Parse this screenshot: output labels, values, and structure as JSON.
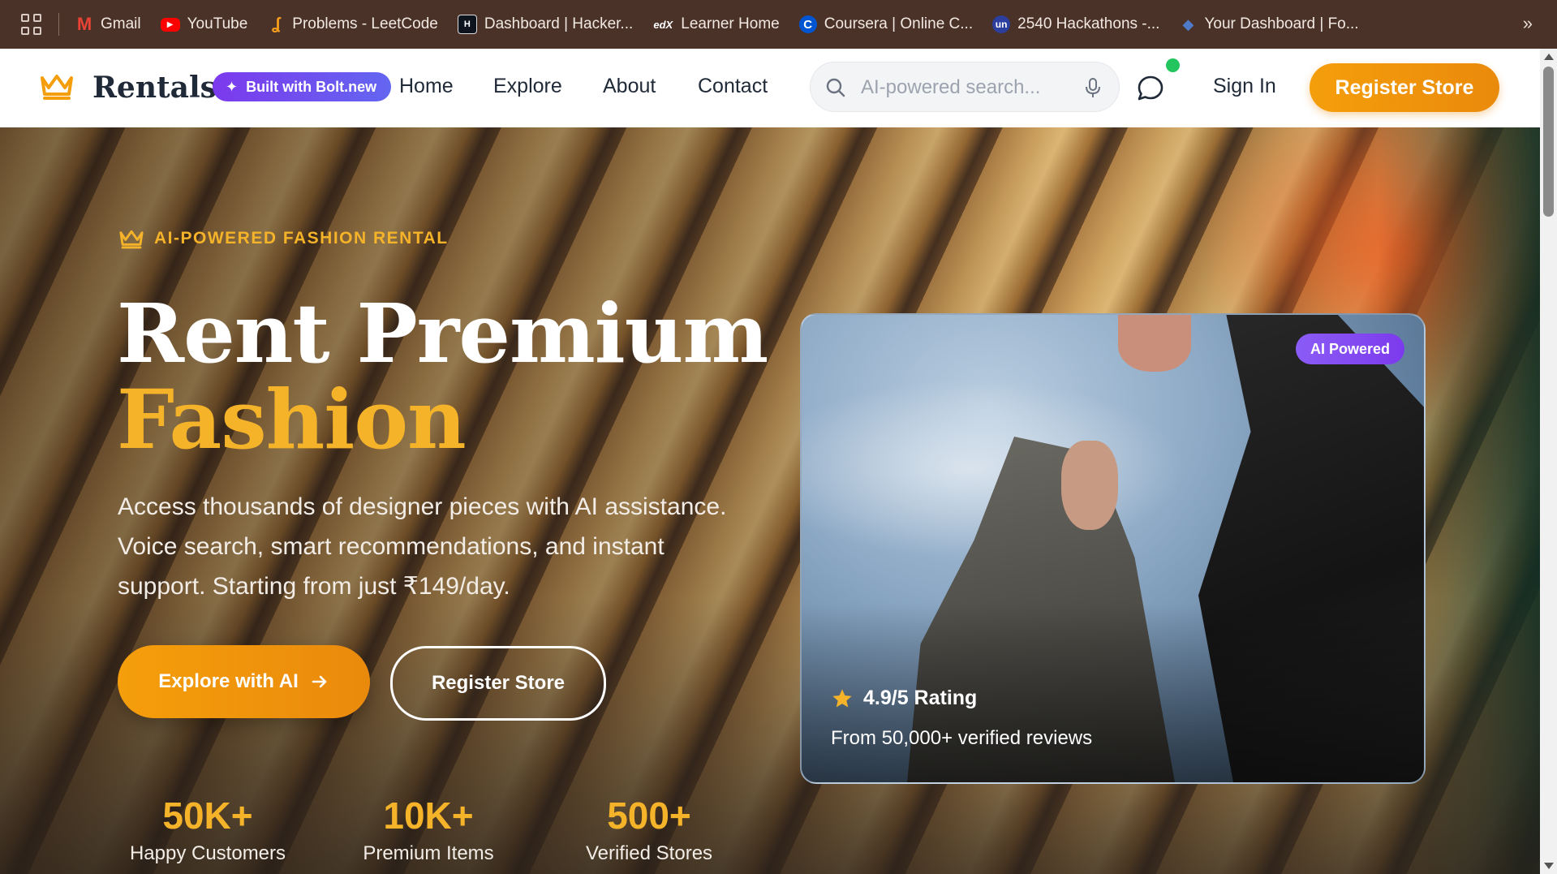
{
  "bookmarks": {
    "items": [
      {
        "label": "Gmail",
        "icon": "gmail-icon"
      },
      {
        "label": "YouTube",
        "icon": "youtube-icon"
      },
      {
        "label": "Problems - LeetCode",
        "icon": "leetcode-icon"
      },
      {
        "label": "Dashboard | Hacker...",
        "icon": "hackerrank-icon"
      },
      {
        "label": "Learner Home",
        "icon": "edx-icon"
      },
      {
        "label": "Coursera | Online C...",
        "icon": "coursera-icon"
      },
      {
        "label": "2540 Hackathons -...",
        "icon": "unstop-icon"
      },
      {
        "label": "Your Dashboard | Fo...",
        "icon": "dashboard-icon"
      }
    ],
    "more_icon": "chevron-double-right-icon"
  },
  "nav": {
    "brand": "Rentals",
    "bolt_badge": "Built with Bolt.new",
    "links": [
      "Home",
      "Explore",
      "About",
      "Contact"
    ],
    "search_placeholder": "AI-powered search...",
    "sign_in": "Sign In",
    "register": "Register Store"
  },
  "hero": {
    "eyebrow": "AI-POWERED FASHION RENTAL",
    "title_line1": "Rent Premium",
    "title_line2": "Fashion",
    "lead": "Access thousands of designer pieces with AI assistance. Voice search, smart recommendations, and instant support. Starting from just ₹149/day.",
    "cta_primary": "Explore with AI",
    "cta_secondary": "Register Store",
    "stats": [
      {
        "value": "50K+",
        "label": "Happy Customers"
      },
      {
        "value": "10K+",
        "label": "Premium Items"
      },
      {
        "value": "500+",
        "label": "Verified Stores"
      }
    ]
  },
  "card": {
    "badge": "AI Powered",
    "rating": "4.9/5 Rating",
    "reviews": "From 50,000+ verified reviews"
  },
  "colors": {
    "accent": "#f59e0b",
    "gold_text": "#f5b32a",
    "purple": "#7c3aed",
    "bookmarks_bg": "#4a3228",
    "online": "#22c55e"
  }
}
